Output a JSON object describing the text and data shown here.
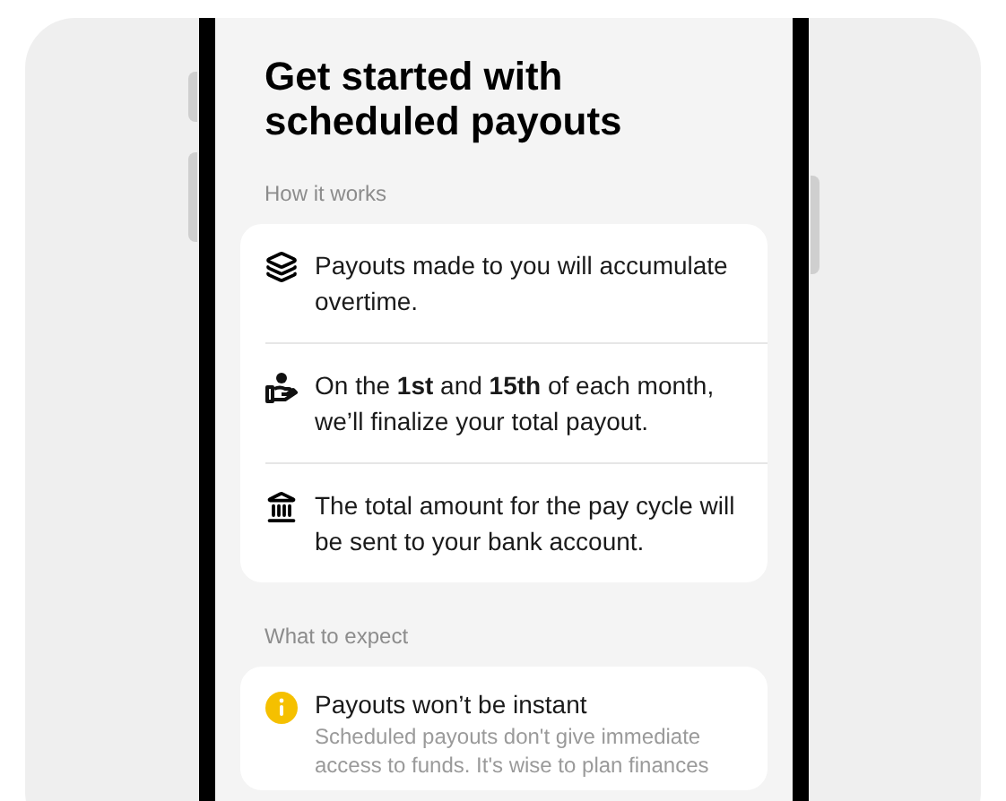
{
  "title": "Get started with scheduled payouts",
  "sections": [
    {
      "heading": "How it works",
      "kind": "steps",
      "items": [
        {
          "kind": "layers",
          "text": "Payouts made to you will accumulate overtime."
        },
        {
          "kind": "hand-coin",
          "text": "On the **1st** and **15th** of each month, we’ll finalize your total payout."
        },
        {
          "kind": "bank",
          "text": "The total amount for the pay cycle will be sent to your bank account."
        }
      ]
    },
    {
      "heading": "What to expect",
      "kind": "notes",
      "items": [
        {
          "kind": "info",
          "title": "Payouts won’t be instant",
          "text": "Scheduled payouts don't give immediate access to funds. It's wise to plan finances"
        }
      ]
    }
  ]
}
